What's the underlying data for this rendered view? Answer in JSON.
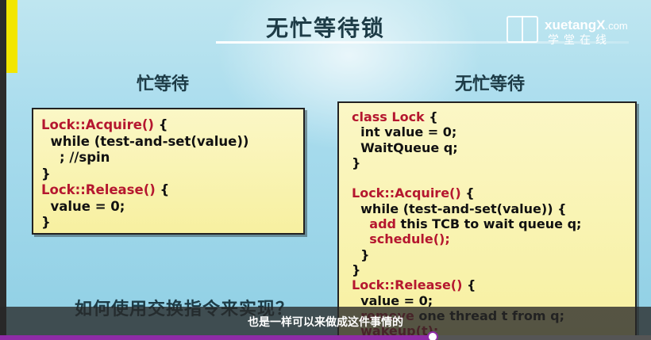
{
  "slide": {
    "title": "无忙等待锁",
    "left_heading": "忙等待",
    "right_heading": "无忙等待",
    "question": "如何使用交换指令来实现？"
  },
  "logo": {
    "text_brand": "xuetangX",
    "text_domain": ".com",
    "text_cn": "学堂在线"
  },
  "busy_wait_code": [
    {
      "kw": "Lock::Acquire()",
      "rest": " {"
    },
    {
      "kw": "",
      "rest": "  while (test-and-set(value))"
    },
    {
      "kw": "",
      "rest": "    ; //spin"
    },
    {
      "kw": "",
      "rest": "}"
    },
    {
      "kw": "Lock::Release()",
      "rest": " {"
    },
    {
      "kw": "",
      "rest": "  value = 0;"
    },
    {
      "kw": "",
      "rest": "}"
    }
  ],
  "no_busy_wait_code": [
    {
      "pre": "",
      "kw": "class Lock",
      "rest": " {"
    },
    {
      "pre": "  int value = 0;",
      "kw": "",
      "rest": ""
    },
    {
      "pre": "  WaitQueue q;",
      "kw": "",
      "rest": ""
    },
    {
      "pre": "}",
      "kw": "",
      "rest": ""
    },
    {
      "pre": "",
      "kw": "",
      "rest": ""
    },
    {
      "pre": "",
      "kw": "Lock::Acquire()",
      "rest": " {"
    },
    {
      "pre": "  while (test-and-set(value)) {",
      "kw": "",
      "rest": ""
    },
    {
      "pre": "    ",
      "kw": "add",
      "rest": " this TCB to wait queue q;"
    },
    {
      "pre": "    ",
      "kw": "schedule();",
      "rest": ""
    },
    {
      "pre": "  }",
      "kw": "",
      "rest": ""
    },
    {
      "pre": "}",
      "kw": "",
      "rest": ""
    },
    {
      "pre": "",
      "kw": "Lock::Release()",
      "rest": " {"
    },
    {
      "pre": "  value = 0;",
      "kw": "",
      "rest": ""
    },
    {
      "pre": "  ",
      "kw": "remove",
      "rest": " one thread t from q;"
    },
    {
      "pre": "  ",
      "kw": "wakeup(t);",
      "rest": ""
    },
    {
      "pre": "}",
      "kw": "",
      "rest": ""
    }
  ],
  "video": {
    "subtitle": "也是一样可以来做成这件事情的",
    "progress_fraction": 0.665
  },
  "colors": {
    "keyword": "#b5172f",
    "box_fill": "#f7f0a0",
    "progress": "#8e2ba6"
  }
}
